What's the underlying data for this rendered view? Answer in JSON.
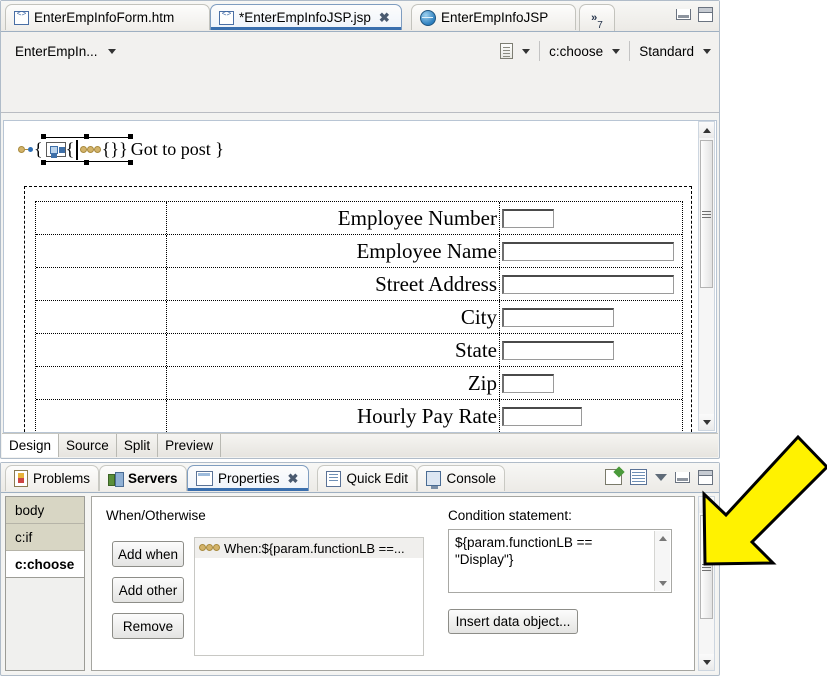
{
  "editor": {
    "tabs": [
      {
        "label": "EnterEmpInfoForm.htm",
        "icon": "jsp-file-icon",
        "active": false,
        "closable": false
      },
      {
        "label": "*EnterEmpInfoJSP.jsp",
        "icon": "jsp-file-icon",
        "active": true,
        "closable": true,
        "close_glyph": "✖"
      },
      {
        "label": "EnterEmpInfoJSP",
        "icon": "globe-icon",
        "active": false,
        "closable": false
      }
    ],
    "overflow_label": "»",
    "overflow_count": "7",
    "toolbar": {
      "page_selector": "EnterEmpIn...",
      "doc_icon": "document-icon",
      "tag_selector": "c:choose",
      "style_selector": "Standard"
    },
    "canvas": {
      "jsp_text": "Got to post }",
      "brace_open": "{",
      "brace_inner_open": "{",
      "braces_empty": "{}",
      "brace_close": "}",
      "form_rows": [
        {
          "label": "Employee Number",
          "input_width": 52
        },
        {
          "label": "Employee Name",
          "input_width": 172
        },
        {
          "label": "Street Address",
          "input_width": 172
        },
        {
          "label": "City",
          "input_width": 112
        },
        {
          "label": "State",
          "input_width": 112
        },
        {
          "label": "Zip",
          "input_width": 52
        },
        {
          "label": "Hourly Pay Rate",
          "input_width": 80
        }
      ]
    },
    "mode_tabs": [
      {
        "label": "Design",
        "selected": true
      },
      {
        "label": "Source",
        "selected": false
      },
      {
        "label": "Split",
        "selected": false
      },
      {
        "label": "Preview",
        "selected": false
      }
    ],
    "window_buttons": [
      "minimize-icon",
      "maximize-icon"
    ]
  },
  "properties_panel": {
    "tabs": [
      {
        "label": "Problems",
        "icon": "problems-icon",
        "active": false,
        "bold": false,
        "closable": false
      },
      {
        "label": "Servers",
        "icon": "servers-icon",
        "active": false,
        "bold": true,
        "closable": false
      },
      {
        "label": "Properties",
        "icon": "properties-icon",
        "active": true,
        "bold": false,
        "closable": true,
        "close_glyph": "✖"
      },
      {
        "label": "Quick Edit",
        "icon": "quick-edit-icon",
        "active": false,
        "bold": false,
        "closable": false
      },
      {
        "label": "Console",
        "icon": "console-icon",
        "active": false,
        "bold": false,
        "closable": false
      }
    ],
    "toolbar_icons": [
      "new-view-icon",
      "grid-icon",
      "view-menu-icon",
      "minimize-icon",
      "maximize-icon"
    ],
    "breadcrumbs": [
      {
        "label": "body",
        "selected": false
      },
      {
        "label": "c:if",
        "selected": false
      },
      {
        "label": "c:choose",
        "selected": true
      }
    ],
    "section_title": "When/Otherwise",
    "buttons": {
      "add_when": "Add when",
      "add_other": "Add other",
      "remove": "Remove",
      "insert_data_object": "Insert data object..."
    },
    "when_items": [
      {
        "label": "When:${param.functionLB ==...",
        "icon": "tag-dots-icon"
      }
    ],
    "condition": {
      "label": "Condition statement:",
      "value": "${param.functionLB == \"Display\"}"
    }
  },
  "annotation": {
    "arrow_color": "#FFF200",
    "arrow_outline": "#000000",
    "arrow_direction": "down-left"
  }
}
